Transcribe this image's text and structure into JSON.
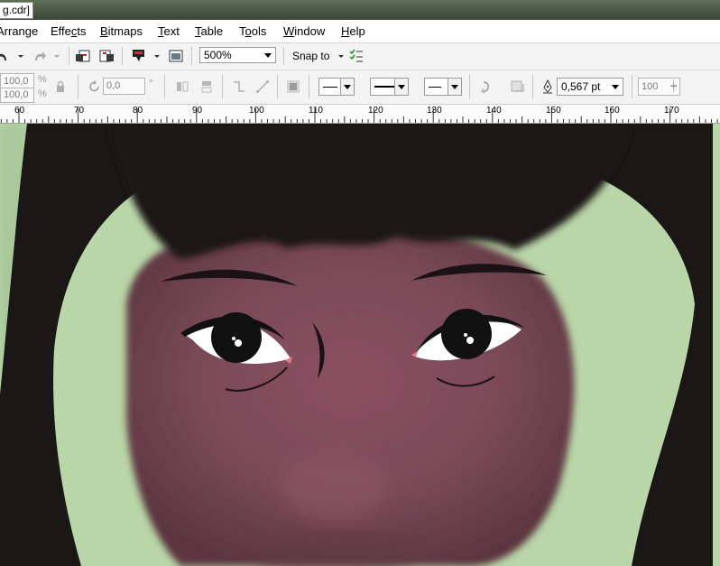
{
  "window": {
    "title": "g.cdr]"
  },
  "menu": [
    {
      "label_pre": "",
      "label_ul": "A",
      "label_post": "rrange"
    },
    {
      "label_pre": "Effe",
      "label_ul": "c",
      "label_post": "ts"
    },
    {
      "label_pre": "",
      "label_ul": "B",
      "label_post": "itmaps"
    },
    {
      "label_pre": "",
      "label_ul": "T",
      "label_post": "ext"
    },
    {
      "label_pre": "",
      "label_ul": "T",
      "label_post": "able"
    },
    {
      "label_pre": "T",
      "label_ul": "o",
      "label_post": "ols"
    },
    {
      "label_pre": "",
      "label_ul": "W",
      "label_post": "indow"
    },
    {
      "label_pre": "",
      "label_ul": "H",
      "label_post": "elp"
    }
  ],
  "toolbar": {
    "zoom": "500%",
    "snap_label": "Snap to"
  },
  "properties": {
    "scale_w": "100,0",
    "scale_h": "100,0",
    "percent": "%",
    "rotation": "0,0",
    "degree": "°",
    "outline_width": "0,567 pt",
    "transparency": "100"
  },
  "ruler": {
    "ticks": [
      "60",
      "70",
      "80",
      "90",
      "100",
      "110",
      "120",
      "130",
      "140",
      "150",
      "160",
      "170"
    ]
  },
  "colors": {
    "skin": "#7b4a59",
    "hair": "#1b1717",
    "background_green": "#b9d6a8"
  }
}
